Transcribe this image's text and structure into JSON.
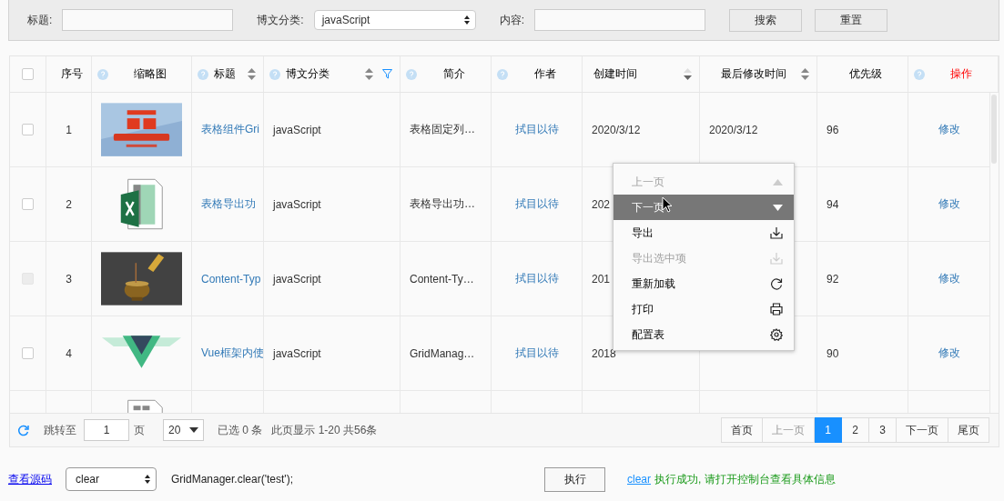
{
  "search_bar": {
    "fields": [
      {
        "label": "标题:",
        "kind": "input"
      },
      {
        "label": "博文分类:",
        "kind": "select",
        "value": "javaScript"
      },
      {
        "label": "内容:",
        "kind": "input"
      }
    ],
    "buttons": [
      "搜索",
      "重置"
    ]
  },
  "table": {
    "select_all": {
      "checked": false
    },
    "columns": [
      {
        "title": "序号",
        "help": false,
        "sortable": false,
        "filter": false,
        "highlight": false
      },
      {
        "title": "缩略图",
        "help": true,
        "sortable": false,
        "filter": false,
        "highlight": false
      },
      {
        "title": "标题",
        "help": true,
        "sortable": true,
        "sorted_desc": false,
        "filter": false,
        "highlight": false
      },
      {
        "title": "博文分类",
        "help": true,
        "sortable": true,
        "sorted_desc": false,
        "filter": true,
        "highlight": false
      },
      {
        "title": "简介",
        "help": true,
        "sortable": false,
        "filter": false,
        "highlight": false
      },
      {
        "title": "作者",
        "help": true,
        "sortable": false,
        "filter": false,
        "highlight": false
      },
      {
        "title": "创建时间",
        "help": false,
        "sortable": true,
        "sorted_desc": true,
        "filter": false,
        "highlight": false
      },
      {
        "title": "最后修改时间",
        "help": false,
        "sortable": true,
        "sorted_desc": false,
        "filter": false,
        "highlight": false
      },
      {
        "title": "优先级",
        "help": false,
        "sortable": false,
        "filter": false,
        "highlight": false
      },
      {
        "title": "操作",
        "help": true,
        "sortable": false,
        "filter": false,
        "highlight": true
      }
    ],
    "rows": [
      {
        "checked": false,
        "disabled": false,
        "index": "1",
        "title": "表格组件Gri",
        "category": "javaScript",
        "summary": "表格固定列…",
        "author": "拭目以待",
        "created": "2020/3/12",
        "modified": "2020/3/12",
        "priority": "96",
        "action": "修改"
      },
      {
        "checked": false,
        "disabled": false,
        "index": "2",
        "title": "表格导出功",
        "category": "javaScript",
        "summary": "表格导出功…",
        "author": "拭目以待",
        "created": "202",
        "priority": "94",
        "action": "修改"
      },
      {
        "checked": false,
        "disabled": true,
        "index": "3",
        "title": "Content-Typ",
        "category": "javaScript",
        "summary": "Content-Ty…",
        "author": "拭目以待",
        "created": "201",
        "priority": "92",
        "action": "修改"
      },
      {
        "checked": false,
        "disabled": false,
        "index": "4",
        "title": "Vue框架内使",
        "category": "javaScript",
        "summary": "GridManag…",
        "author": "拭目以待",
        "created": "2018",
        "priority": "90",
        "action": "修改"
      }
    ]
  },
  "footer": {
    "jump_label": "跳转至",
    "page_input": "1",
    "page_unit": "页",
    "page_size": "20",
    "selected_info": "已选 0 条",
    "range_info": "此页显示 1-20 共56条",
    "pages": [
      {
        "label": "首页",
        "disabled": false,
        "selected": false
      },
      {
        "label": "上一页",
        "disabled": true,
        "selected": false
      },
      {
        "label": "1",
        "disabled": false,
        "selected": true
      },
      {
        "label": "2",
        "disabled": false,
        "selected": false
      },
      {
        "label": "3",
        "disabled": false,
        "selected": false
      },
      {
        "label": "下一页",
        "disabled": false,
        "selected": false
      },
      {
        "label": "尾页",
        "disabled": false,
        "selected": false
      }
    ]
  },
  "context_menu": [
    {
      "label": "上一页",
      "kind": "up",
      "disabled": true,
      "highlighted": false
    },
    {
      "label": "下一页",
      "kind": "down",
      "disabled": false,
      "highlighted": true
    },
    {
      "label": "导出",
      "kind": "download",
      "disabled": false,
      "highlighted": false
    },
    {
      "label": "导出选中项",
      "kind": "download",
      "disabled": true,
      "highlighted": false
    },
    {
      "label": "重新加载",
      "kind": "refresh",
      "disabled": false,
      "highlighted": false
    },
    {
      "label": "打印",
      "kind": "print",
      "disabled": false,
      "highlighted": false
    },
    {
      "label": "配置表",
      "kind": "gear",
      "disabled": false,
      "highlighted": false
    }
  ],
  "demo_bar": {
    "source_link": "查看源码",
    "method": "clear",
    "code": "GridManager.clear('test');",
    "run_button": "执行",
    "result_link": "clear",
    "result_message": "执行成功, 请打开控制台查看具体信息"
  }
}
